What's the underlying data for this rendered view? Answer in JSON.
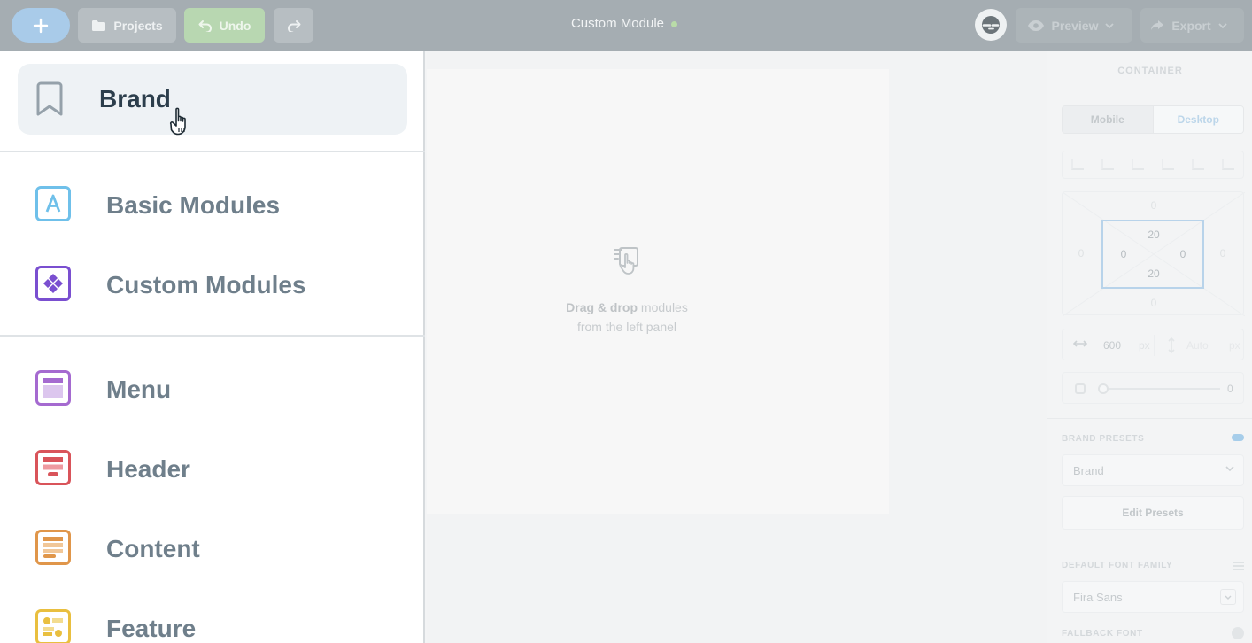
{
  "toolbar": {
    "projects_label": "Projects",
    "undo_label": "Undo",
    "document_title": "Custom Module",
    "preview_label": "Preview",
    "export_label": "Export"
  },
  "sidebar": {
    "brand_label": "Brand",
    "groups": [
      {
        "items": [
          {
            "label": "Basic Modules",
            "icon": "letter-a-icon",
            "color": "#6fc0ea"
          },
          {
            "label": "Custom Modules",
            "icon": "diamond-grid-icon",
            "color": "#7a4fd0"
          }
        ]
      },
      {
        "items": [
          {
            "label": "Menu",
            "icon": "menu-block-icon",
            "color": "#a56ad0"
          },
          {
            "label": "Header",
            "icon": "header-block-icon",
            "color": "#d9545a"
          },
          {
            "label": "Content",
            "icon": "content-block-icon",
            "color": "#e0964a"
          },
          {
            "label": "Feature",
            "icon": "feature-block-icon",
            "color": "#e9bf3f"
          }
        ]
      }
    ]
  },
  "canvas": {
    "drop_strong": "Drag & drop",
    "drop_rest": " modules",
    "drop_line2": "from the left panel"
  },
  "panel": {
    "title": "CONTAINER",
    "device_mobile": "Mobile",
    "device_desktop": "Desktop",
    "spacing": {
      "margin_top": "0",
      "margin_right": "0",
      "margin_bottom": "0",
      "margin_left": "0",
      "padding_top": "20",
      "padding_right": "0",
      "padding_bottom": "20",
      "padding_left": "0"
    },
    "width_value": "600",
    "width_unit": "px",
    "height_value": "Auto",
    "height_unit": "px",
    "radius_value": "0",
    "brand_presets_label": "BRAND PRESETS",
    "brand_presets_value": "Brand",
    "edit_presets_label": "Edit Presets",
    "default_font_label": "DEFAULT FONT FAMILY",
    "default_font_value": "Fira Sans",
    "fallback_font_label": "FALLBACK FONT"
  }
}
